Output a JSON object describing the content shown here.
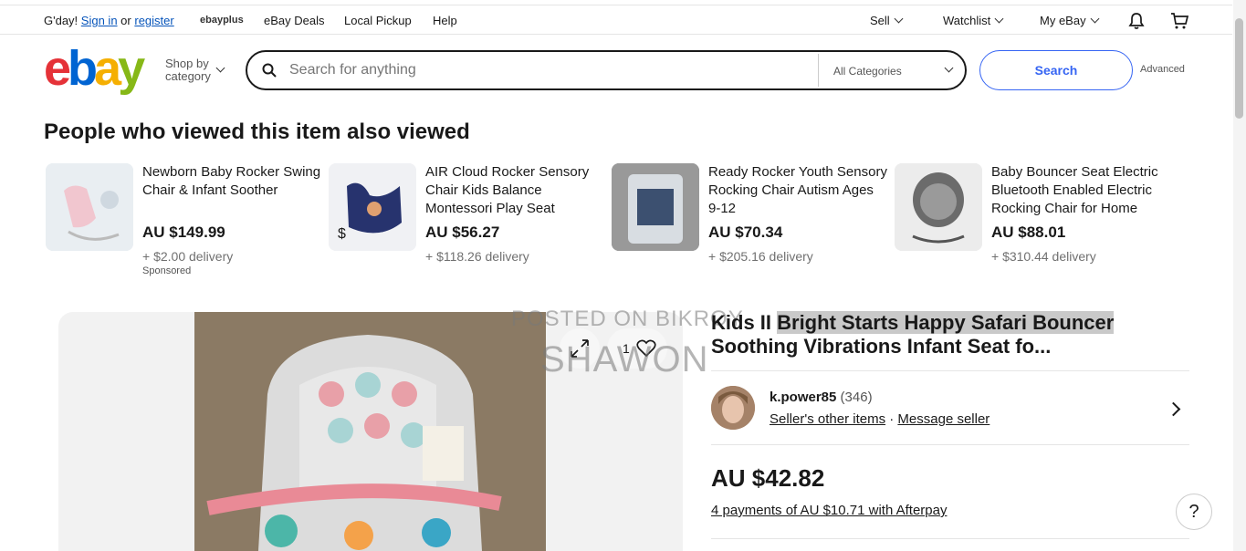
{
  "topbar": {
    "greeting": "G'day!",
    "sign_in": "Sign in",
    "or": "or",
    "register": "register",
    "ebayplus": "ebayplus",
    "deals": "eBay Deals",
    "local_pickup": "Local Pickup",
    "help": "Help",
    "sell": "Sell",
    "watchlist": "Watchlist",
    "my_ebay": "My eBay"
  },
  "header": {
    "logo_letters": [
      "e",
      "b",
      "a",
      "y"
    ],
    "shop_by_line1": "Shop by",
    "shop_by_line2": "category",
    "search_placeholder": "Search for anything",
    "category": "All Categories",
    "search_button": "Search",
    "advanced": "Advanced"
  },
  "also_viewed": {
    "title": "People who viewed this item also viewed",
    "items": [
      {
        "title": "Newborn Baby Rocker Swing Chair & Infant Soother",
        "price": "AU $149.99",
        "delivery": "+ $2.00 delivery",
        "sponsored": "Sponsored"
      },
      {
        "title": "AIR Cloud Rocker Sensory Chair Kids Balance Montessori Play Seat Brand...",
        "price": "AU $56.27",
        "delivery": "+ $118.26 delivery",
        "sponsored": ""
      },
      {
        "title": "Ready Rocker Youth Sensory Rocking Chair Autism Ages 9-12",
        "price": "AU $70.34",
        "delivery": "+ $205.16 delivery",
        "sponsored": ""
      },
      {
        "title": "Baby Bouncer Seat Electric Bluetooth Enabled Electric Rocking Chair for Home",
        "price": "AU $88.01",
        "delivery": "+ $310.44 delivery",
        "sponsored": ""
      }
    ]
  },
  "item": {
    "title_prefix": "Kids II ",
    "title_highlight": "Bright Starts Happy Safari Bouncer",
    "title_rest": "Soothing Vibrations Infant Seat fo...",
    "watch_count": "1",
    "watermark_line1": "POSTED ON BIKROY",
    "watermark_line2": "SHAWON",
    "seller": {
      "name": "k.power85",
      "count": "(346)",
      "other_items": "Seller's other items",
      "separator": "·",
      "message": "Message seller"
    },
    "price": "AU $42.82",
    "afterpay": "4 payments of AU $10.71 with Afterpay"
  },
  "help_button": "?"
}
